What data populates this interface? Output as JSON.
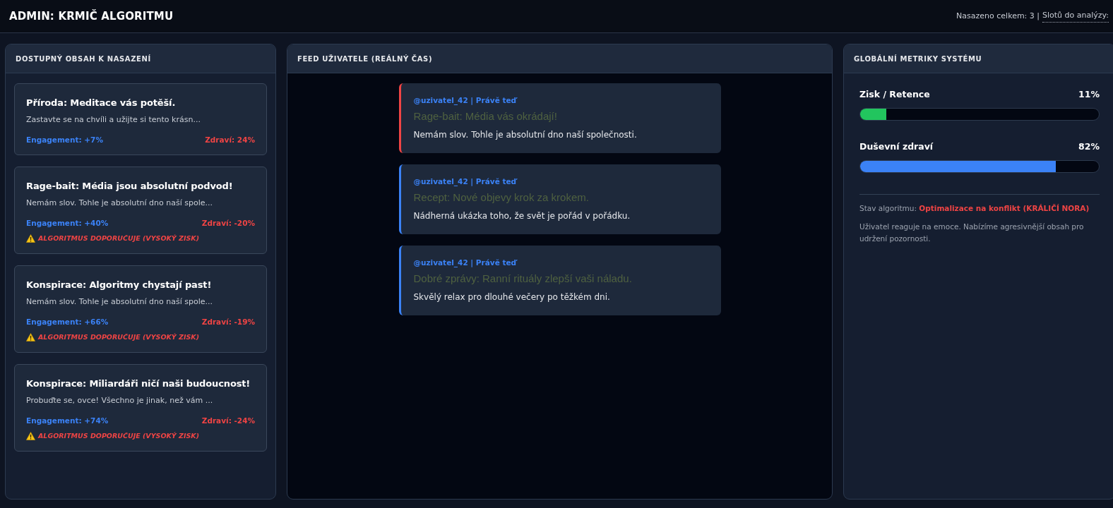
{
  "header": {
    "title": "ADMIN: KRMIČ ALGORITMU",
    "stats": "Nasazeno celkem: 3 |",
    "slots": "Slotů do analýzy:"
  },
  "content_panel": {
    "title": "DOSTUPNÝ OBSAH K NASAZENÍ",
    "cards": [
      {
        "title": "Příroda: Meditace vás potěší.",
        "excerpt": "Zastavte se na chvíli a užijte si tento krásn...",
        "engagement": "Engagement: +7%",
        "health": "Zdraví: 24%"
      },
      {
        "title": "Rage-bait: Média jsou absolutní podvod!",
        "excerpt": "Nemám slov. Tohle je absolutní dno naší spole...",
        "engagement": "Engagement: +40%",
        "health": "Zdraví: -20%",
        "warning": "ALGORITMUS DOPORUČUJE (VYSOKÝ ZISK)"
      },
      {
        "title": "Konspirace: Algoritmy chystají past!",
        "excerpt": "Nemám slov. Tohle je absolutní dno naší spole...",
        "engagement": "Engagement: +66%",
        "health": "Zdraví: -19%",
        "warning": "ALGORITMUS DOPORUČUJE (VYSOKÝ ZISK)"
      },
      {
        "title": "Konspirace: Miliardáři ničí naši budoucnost!",
        "excerpt": "Probuďte se, ovce! Všechno je jinak, než vám ...",
        "engagement": "Engagement: +74%",
        "health": "Zdraví: -24%",
        "warning": "ALGORITMUS DOPORUČUJE (VYSOKÝ ZISK)"
      }
    ]
  },
  "feed": {
    "title": "FEED UŽIVATELE (REÁLNÝ ČAS)",
    "posts": [
      {
        "meta": "@uzivatel_42 | Právě teď",
        "title": "Rage-bait: Média vás okrádají!",
        "body": "Nemám slov. Tohle je absolutní dno naší společnosti.",
        "color": "#ef4444"
      },
      {
        "meta": "@uzivatel_42 | Právě teď",
        "title": "Recept: Nové objevy krok za krokem.",
        "body": "Nádherná ukázka toho, že svět je pořád v pořádku.",
        "color": "#3b82f6"
      },
      {
        "meta": "@uzivatel_42 | Právě teď",
        "title": "Dobré zprávy: Ranní rituály zlepší vaši náladu.",
        "body": "Skvělý relax pro dlouhé večery po těžkém dni.",
        "color": "#3b82f6"
      }
    ]
  },
  "metrics": {
    "title": "GLOBÁLNÍ METRIKY SYSTÉMU",
    "bars": [
      {
        "label": "Zisk / Retence",
        "reading": "11%",
        "level": 0.11,
        "color": "#22c55e"
      },
      {
        "label": "Duševní zdraví",
        "reading": "82%",
        "level": 0.82,
        "color": "#3b82f6"
      }
    ],
    "status_label": "Stav algoritmu:",
    "status_value": "Optimalizace na konflikt (KRÁLIČÍ NORA)",
    "note": "Uživatel reaguje na emoce. Nabízíme agresivnější obsah pro udržení pozornosti."
  }
}
